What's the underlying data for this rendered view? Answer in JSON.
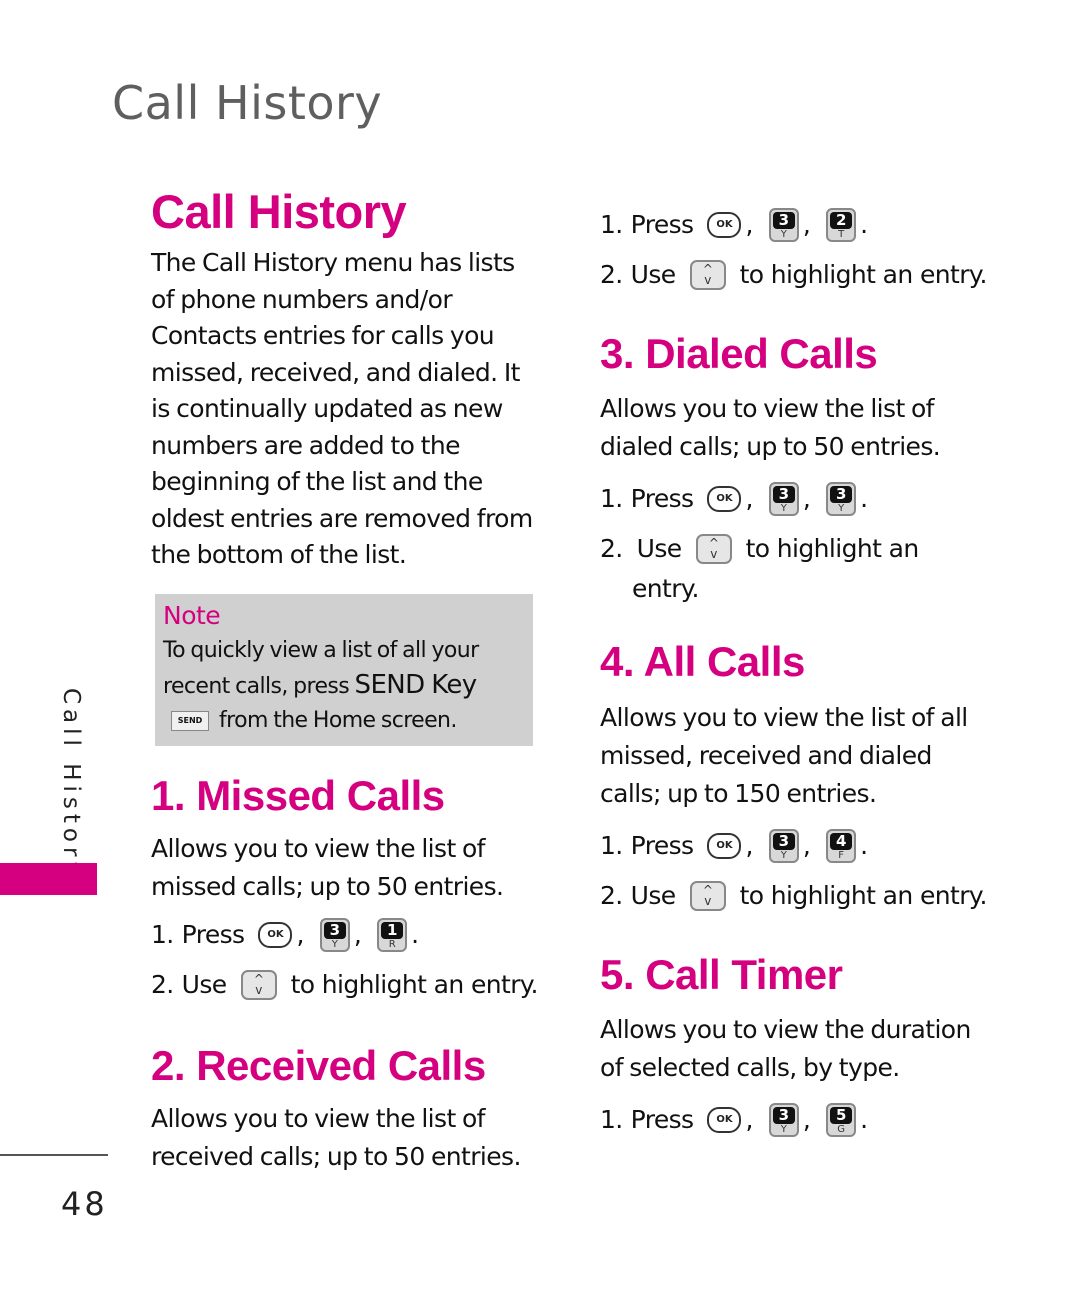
{
  "page": {
    "header_title": "Call History",
    "side_tab_label": "Call History",
    "accent_color": "#d4007f",
    "page_number": "48"
  },
  "intro": {
    "title": "Call History",
    "text": "The Call History menu has lists of phone numbers and/or Contacts entries for calls you missed, received, and dialed. It is continually updated as new numbers are added to the beginning of the list and the oldest entries are removed from the bottom of the list."
  },
  "note": {
    "title": "Note",
    "text_line1": "To quickly view a list of all your recent calls, press",
    "key_name": "SEND Key",
    "send_key_label": "SEND",
    "text_line2": "from the Home screen."
  },
  "keys": {
    "ok_label": "OK",
    "nav_up": "^",
    "nav_down": "v"
  },
  "sections": [
    {
      "title": "1. Missed Calls",
      "description": "Allows you to view the list of missed calls; up to 50 entries.",
      "step1": {
        "num": "1.",
        "text": "Press",
        "keys": [
          {
            "digit": "3",
            "letter": "Y"
          },
          {
            "digit": "1",
            "letter": "R"
          }
        ]
      },
      "step2": {
        "num": "2.",
        "text_before": "Use",
        "text_after": "to highlight an entry."
      }
    },
    {
      "title": "2. Received Calls",
      "description": "Allows you to view the list of received calls; up to 50 entries.",
      "step1": {
        "num": "1.",
        "text": "Press",
        "keys": [
          {
            "digit": "3",
            "letter": "Y"
          },
          {
            "digit": "2",
            "letter": "T"
          }
        ]
      },
      "step2": {
        "num": "2.",
        "text_before": "Use",
        "text_after": "to highlight an entry."
      }
    },
    {
      "title": "3. Dialed Calls",
      "description": "Allows you to view the list of dialed calls; up to 50 entries.",
      "step1": {
        "num": "1.",
        "text": "Press",
        "keys": [
          {
            "digit": "3",
            "letter": "Y"
          },
          {
            "digit": "3",
            "letter": "Y"
          }
        ]
      },
      "step2": {
        "num": "2.",
        "text_before": "Use",
        "text_after": "to highlight an",
        "text_wrap": "entry."
      }
    },
    {
      "title": "4. All Calls",
      "description": "Allows you to view the list of all missed, received and dialed calls; up to 150 entries.",
      "step1": {
        "num": "1.",
        "text": "Press",
        "keys": [
          {
            "digit": "3",
            "letter": "Y"
          },
          {
            "digit": "4",
            "letter": "F"
          }
        ]
      },
      "step2": {
        "num": "2.",
        "text_before": "Use",
        "text_after": "to highlight an entry."
      }
    },
    {
      "title": "5. Call Timer",
      "description": "Allows you to view the duration of selected calls, by type.",
      "step1": {
        "num": "1.",
        "text": "Press",
        "keys": [
          {
            "digit": "3",
            "letter": "Y"
          },
          {
            "digit": "5",
            "letter": "G"
          }
        ]
      }
    }
  ]
}
